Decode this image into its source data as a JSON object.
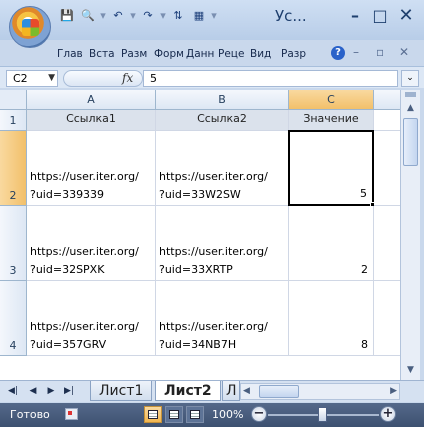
{
  "window": {
    "title": "Ус...",
    "buttons": {
      "minimize": "–",
      "maximize": "□",
      "close": "✕"
    }
  },
  "qat": [
    "save-icon",
    "print-preview-icon",
    "undo-icon",
    "redo-icon",
    "sort-icon",
    "chart-icon"
  ],
  "ribbon": {
    "tabs": [
      "Глав",
      "Вста",
      "Разм",
      "Форм",
      "Данн",
      "Реце",
      "Вид",
      "Разр"
    ],
    "help": "?"
  },
  "formula_bar": {
    "name_box": "C2",
    "fx": "fx",
    "content": "5"
  },
  "grid": {
    "columns": [
      "A",
      "B",
      "C"
    ],
    "rows": [
      "1",
      "2",
      "3",
      "4"
    ],
    "header_row": [
      "Ссылка1",
      "Ссылка2",
      "Значение"
    ],
    "data": [
      {
        "a1": "https://user.iter.org/",
        "a2": "?uid=339339",
        "b1": "https://user.iter.org/",
        "b2": "?uid=33W2SW",
        "c": "5"
      },
      {
        "a1": "https://user.iter.org/",
        "a2": "?uid=32SPXK",
        "b1": "https://user.iter.org/",
        "b2": "?uid=33XRTP",
        "c": "2"
      },
      {
        "a1": "https://user.iter.org/",
        "a2": "?uid=357GRV",
        "b1": "https://user.iter.org/",
        "b2": "?uid=34NB7H",
        "c": "8"
      }
    ],
    "active_cell": "C2"
  },
  "sheets": {
    "tabs": [
      "Лист1",
      "Лист2",
      "Л"
    ],
    "active": "Лист2"
  },
  "status": {
    "text": "Готово",
    "zoom": "100%",
    "zoom_value_percent": 100
  }
}
